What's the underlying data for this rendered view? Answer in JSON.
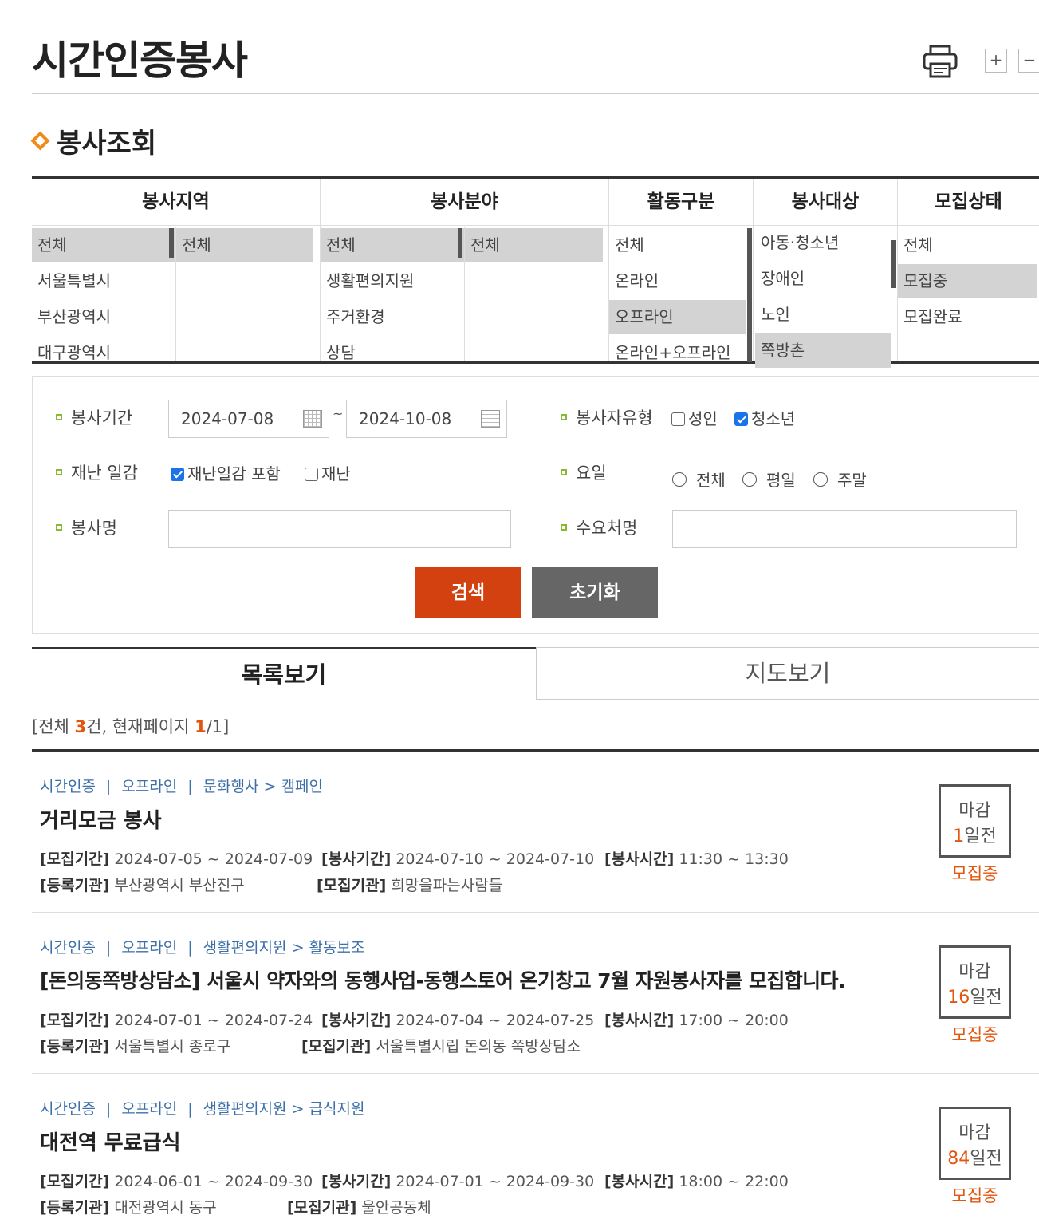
{
  "header": {
    "title": "시간인증봉사",
    "zoom_in": "+",
    "zoom_out": "−"
  },
  "section": {
    "title": "봉사조회"
  },
  "filters": {
    "region": {
      "label": "봉사지역",
      "list1": [
        "전체",
        "서울특별시",
        "부산광역시",
        "대구광역시"
      ],
      "list2": [
        "전체"
      ]
    },
    "field": {
      "label": "봉사분야",
      "list1": [
        "전체",
        "생활편의지원",
        "주거환경",
        "상담"
      ],
      "list2": [
        "전체"
      ]
    },
    "activity": {
      "label": "활동구분",
      "list": [
        "전체",
        "온라인",
        "오프라인",
        "온라인+오프라인"
      ]
    },
    "target": {
      "label": "봉사대상",
      "list": [
        "아동·청소년",
        "장애인",
        "노인",
        "쪽방촌"
      ]
    },
    "recruit": {
      "label": "모집상태",
      "list": [
        "전체",
        "모집중",
        "모집완료"
      ]
    }
  },
  "search": {
    "period_label": "봉사기간",
    "date_from": "2024-07-08",
    "tilde": "~",
    "date_to": "2024-10-08",
    "volunteer_type_label": "봉사자유형",
    "adult": "성인",
    "youth": "청소년",
    "disaster_label": "재난 일감",
    "disaster_include": "재난일감 포함",
    "disaster": "재난",
    "day_label": "요일",
    "day_all": "전체",
    "day_weekday": "평일",
    "day_weekend": "주말",
    "name_label": "봉사명",
    "demand_label": "수요처명",
    "search_button": "검색",
    "reset_button": "초기화"
  },
  "tabs": {
    "list": "목록보기",
    "map": "지도보기"
  },
  "summary": {
    "prefix": "[전체 ",
    "total": "3",
    "mid": "건, 현재페이지 ",
    "page": "1",
    "suffix": "/1]"
  },
  "items": [
    {
      "type": "시간인증",
      "mode": "오프라인",
      "category": "문화행사 > 캠페인",
      "title": "거리모금 봉사",
      "recruit_period_label": "[모집기간]",
      "recruit_period": "2024-07-05 ~ 2024-07-09",
      "service_period_label": "[봉사기간]",
      "service_period": "2024-07-10 ~ 2024-07-10",
      "service_time_label": "[봉사시간]",
      "service_time": "11:30 ~ 13:30",
      "reg_org_label": "[등록기관]",
      "reg_org": "부산광역시 부산진구",
      "recruit_org_label": "[모집기관]",
      "recruit_org": "희망을파는사람들",
      "deadline_label": "마감",
      "days": "1",
      "days_suffix": "일전",
      "status": "모집중"
    },
    {
      "type": "시간인증",
      "mode": "오프라인",
      "category": "생활편의지원 > 활동보조",
      "title": "[돈의동쪽방상담소] 서울시 약자와의 동행사업-동행스토어 온기창고 7월 자원봉사자를 모집합니다.",
      "recruit_period_label": "[모집기간]",
      "recruit_period": "2024-07-01 ~ 2024-07-24",
      "service_period_label": "[봉사기간]",
      "service_period": "2024-07-04 ~ 2024-07-25",
      "service_time_label": "[봉사시간]",
      "service_time": "17:00 ~ 20:00",
      "reg_org_label": "[등록기관]",
      "reg_org": "서울특별시 종로구",
      "recruit_org_label": "[모집기관]",
      "recruit_org": "서울특별시립 돈의동 쪽방상담소",
      "deadline_label": "마감",
      "days": "16",
      "days_suffix": "일전",
      "status": "모집중"
    },
    {
      "type": "시간인증",
      "mode": "오프라인",
      "category": "생활편의지원 > 급식지원",
      "title": "대전역 무료급식",
      "recruit_period_label": "[모집기간]",
      "recruit_period": "2024-06-01 ~ 2024-09-30",
      "service_period_label": "[봉사기간]",
      "service_period": "2024-07-01 ~ 2024-09-30",
      "service_time_label": "[봉사시간]",
      "service_time": "18:00 ~ 22:00",
      "reg_org_label": "[등록기관]",
      "reg_org": "대전광역시 동구",
      "recruit_org_label": "[모집기관]",
      "recruit_org": "울안공동체",
      "deadline_label": "마감",
      "days": "84",
      "days_suffix": "일전",
      "status": "모집중"
    }
  ],
  "colors": {
    "accent": "#d2410f",
    "highlight": "#e2560f",
    "link": "#3d6fa8",
    "selected_bg": "#d3d3d3"
  }
}
